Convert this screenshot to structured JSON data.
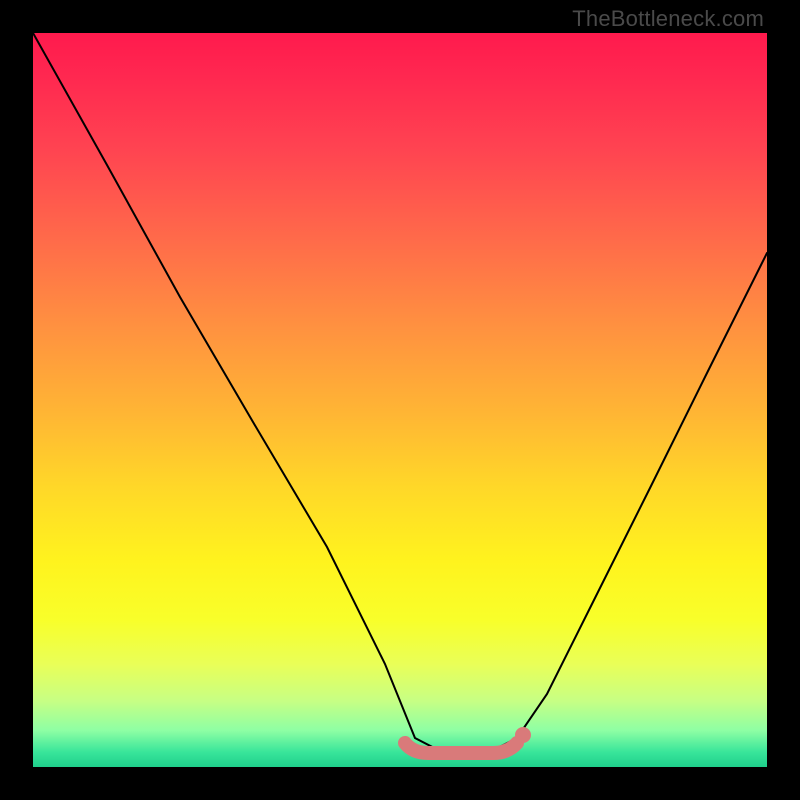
{
  "attribution": "TheBottleneck.com",
  "chart_data": {
    "type": "line",
    "title": "",
    "xlabel": "",
    "ylabel": "",
    "xlim": [
      0,
      100
    ],
    "ylim": [
      0,
      100
    ],
    "series": [
      {
        "name": "bottleneck-curve",
        "x": [
          0,
          10,
          20,
          30,
          40,
          48,
          52,
          56,
          62,
          66,
          70,
          76,
          84,
          92,
          100
        ],
        "values": [
          100,
          82,
          64,
          47,
          30,
          14,
          4,
          2,
          2,
          4,
          10,
          22,
          38,
          54,
          70
        ]
      }
    ],
    "annotations": [
      {
        "name": "optimal-range",
        "x_start": 50,
        "x_end": 66,
        "y": 3
      },
      {
        "name": "optimal-dot",
        "x": 66,
        "y": 4
      }
    ],
    "background_gradient_semantic": "red-top (bad) → green-bottom (good)"
  }
}
